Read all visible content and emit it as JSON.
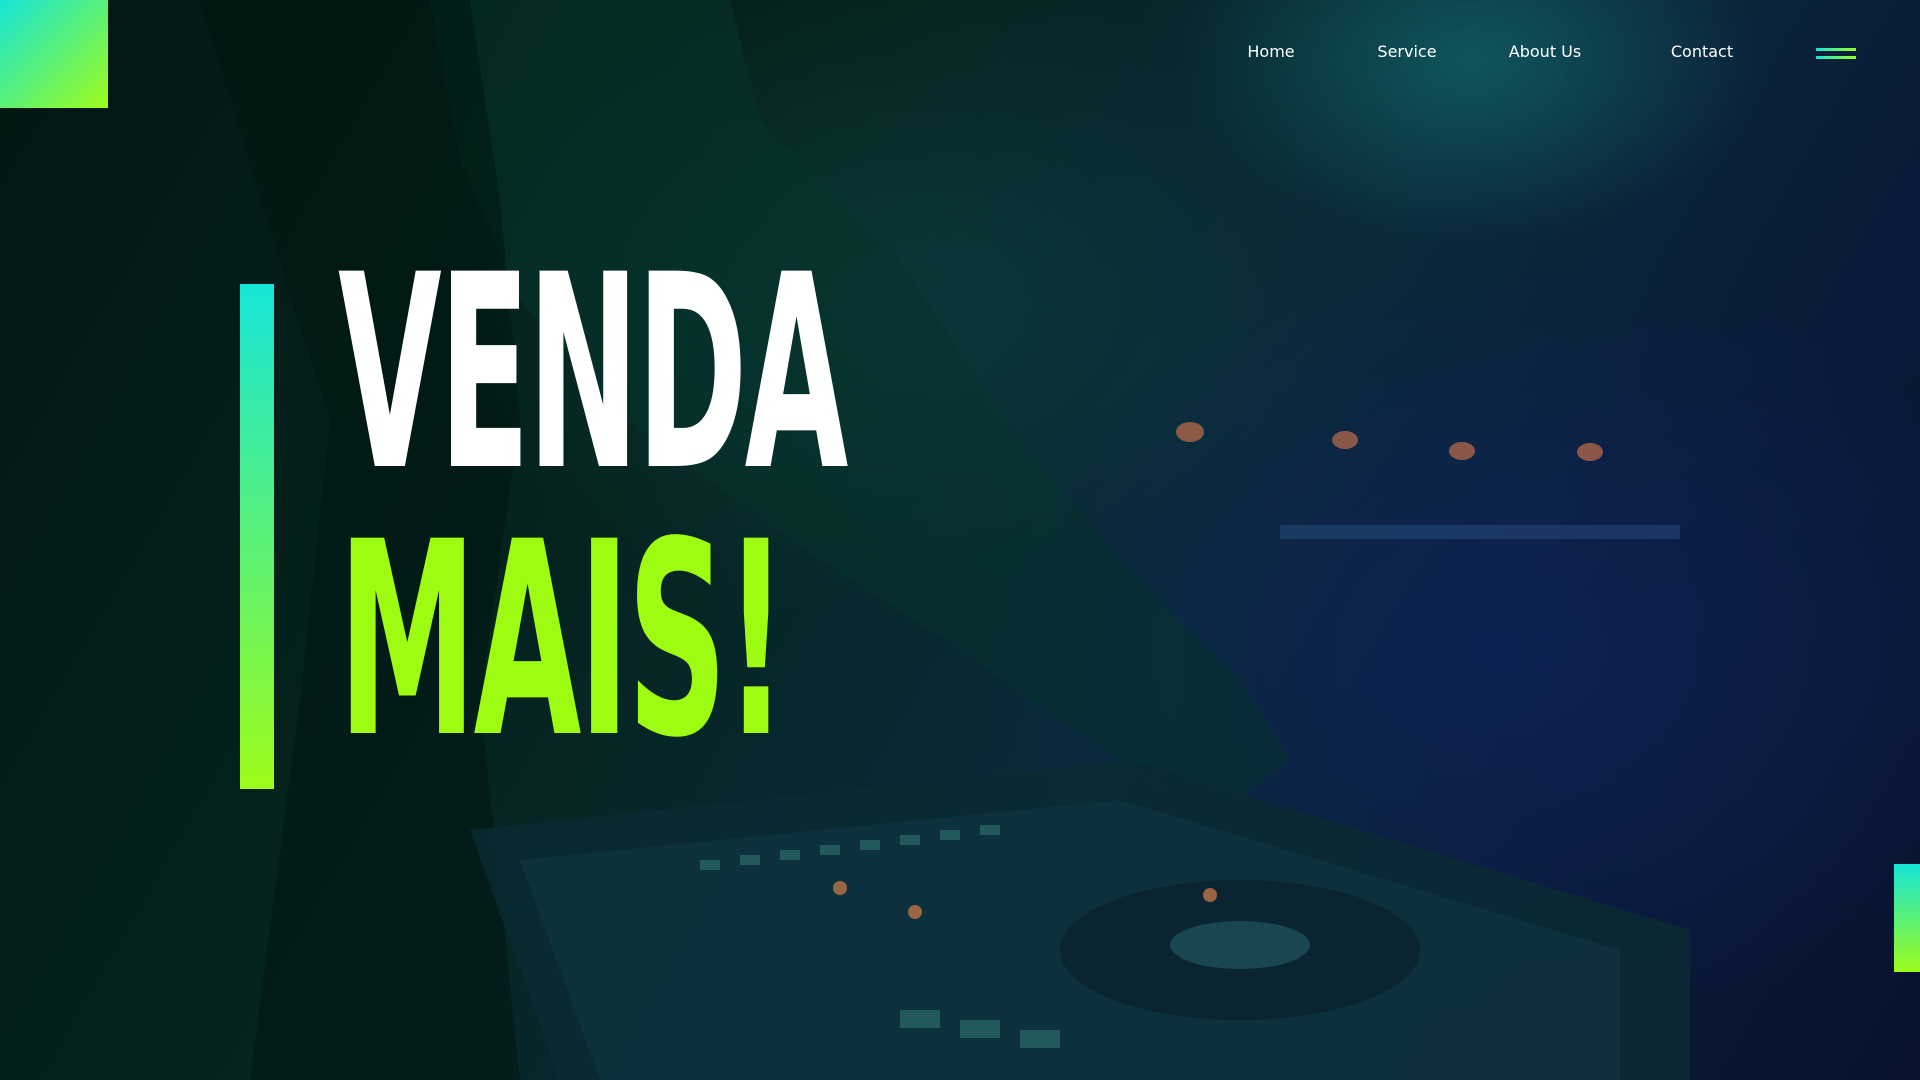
{
  "colors": {
    "accent_cyan": "#16e5d8",
    "accent_green": "#9efc12",
    "headline_white": "#ffffff"
  },
  "nav": {
    "items": [
      {
        "label": "Home"
      },
      {
        "label": "Service"
      },
      {
        "label": "About Us"
      },
      {
        "label": "Contact"
      }
    ],
    "menu_icon": "hamburger-menu-icon"
  },
  "hero": {
    "line1": "VENDA",
    "line2": "MAIS!"
  }
}
